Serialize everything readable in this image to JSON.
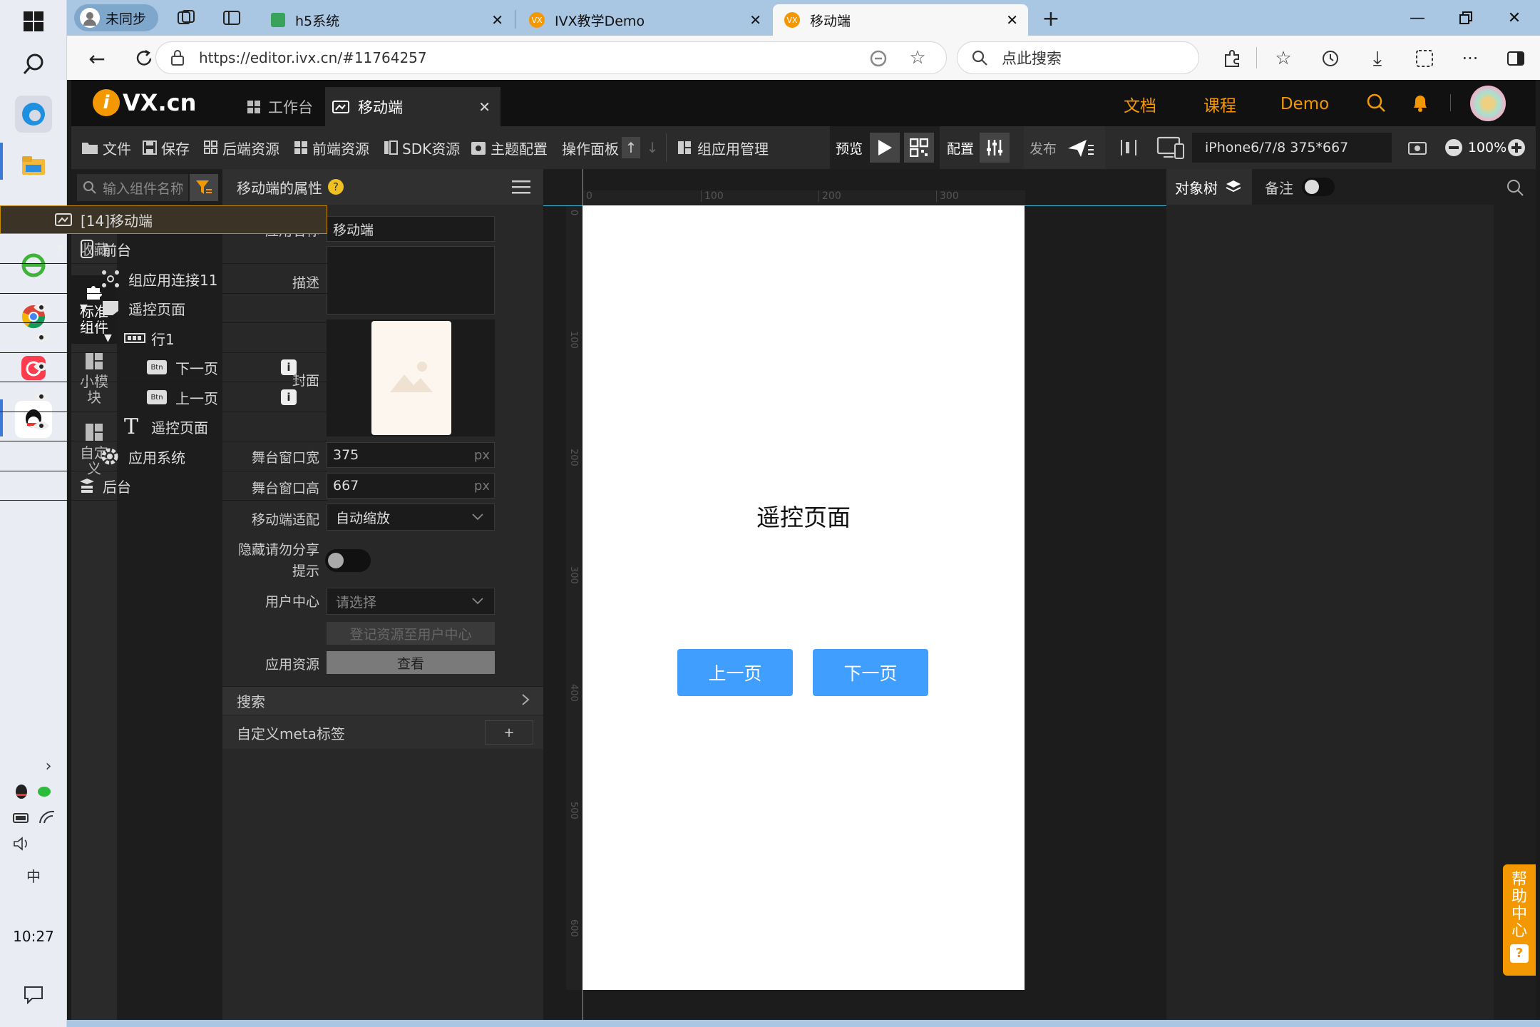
{
  "taskbar": {
    "time": "10:27",
    "ime": "中"
  },
  "browser": {
    "profile": "未同步",
    "tabs": [
      {
        "label": "h5系统"
      },
      {
        "label": "IVX教学Demo"
      },
      {
        "label": "移动端"
      }
    ],
    "url": "https://editor.ivx.cn/#11764257",
    "search_placeholder": "点此搜索"
  },
  "ivx": {
    "logo_text": "VX.cn",
    "tabs": [
      {
        "label": "工作台"
      },
      {
        "label": "移动端"
      }
    ],
    "nav": {
      "docs": "文档",
      "course": "课程",
      "demo": "Demo"
    },
    "toolbar": {
      "file": "文件",
      "save": "保存",
      "backend": "后端资源",
      "frontend": "前端资源",
      "sdk": "SDK资源",
      "theme": "主题配置",
      "ops": "操作面板",
      "app_mgmt": "组应用管理",
      "preview": "预览",
      "config": "配置",
      "publish": "发布",
      "device": "iPhone6/7/8 375*667",
      "zoom": "100%"
    },
    "left_nav": [
      {
        "label": "收藏"
      },
      {
        "label": "标准组件"
      },
      {
        "label": "小模块"
      },
      {
        "label": "自定义"
      }
    ],
    "component_search_placeholder": "输入组件名称",
    "props": {
      "title": "移动端的属性",
      "app_name_label": "应用名称",
      "app_name": "移动端",
      "desc_label": "描述",
      "cover_label": "封面",
      "stage_w_label": "舞台窗口宽",
      "stage_w": "375",
      "stage_h_label": "舞台窗口高",
      "stage_h": "667",
      "unit": "px",
      "adapt_label": "移动端适配",
      "adapt_value": "自动缩放",
      "hide_share_label_1": "隐藏请勿分享",
      "hide_share_label_2": "提示",
      "user_center_label": "用户中心",
      "user_center_placeholder": "请选择",
      "register_btn": "登记资源至用户中心",
      "app_res_label": "应用资源",
      "view_btn": "查看",
      "search_section": "搜索",
      "meta_section": "自定义meta标签",
      "add": "+"
    },
    "ruler_x": [
      "0",
      "100",
      "200",
      "300"
    ],
    "ruler_y": [
      "0",
      "100",
      "200",
      "300",
      "400",
      "500",
      "600"
    ],
    "canvas": {
      "page_title": "遥控页面",
      "prev_btn": "上一页",
      "next_btn": "下一页"
    },
    "tree": {
      "tab_label": "对象树",
      "note_label": "备注",
      "rows": [
        {
          "label": "[14]移动端"
        },
        {
          "label": "前台"
        },
        {
          "label": "组应用连接11"
        },
        {
          "label": "遥控页面"
        },
        {
          "label": "行1"
        },
        {
          "label": "下一页",
          "badge": "Btn"
        },
        {
          "label": "上一页",
          "badge": "Btn"
        },
        {
          "label": "遥控页面"
        },
        {
          "label": "应用系统"
        },
        {
          "label": "后台"
        }
      ]
    },
    "help": "帮助中心",
    "help_q": "?"
  },
  "colors": {
    "accent": "#f39800",
    "button_blue": "#409eff",
    "selected_border": "#c58a00"
  }
}
